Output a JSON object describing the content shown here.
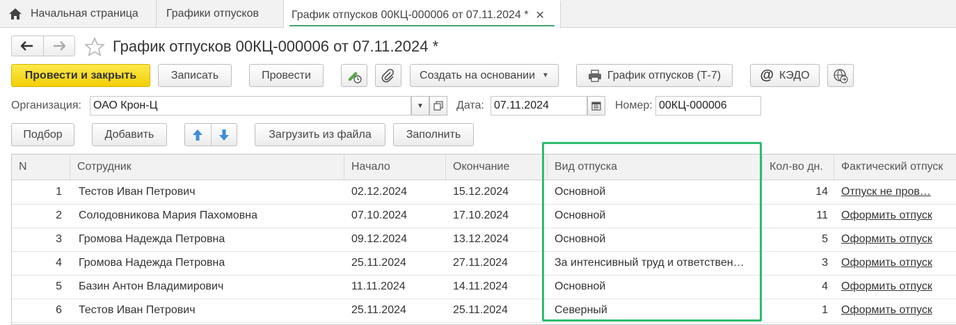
{
  "tabs": [
    {
      "label": "Начальная страница"
    },
    {
      "label": "Графики отпусков"
    },
    {
      "label": "График отпусков 00КЦ-000006 от 07.11.2024 *"
    }
  ],
  "title": "График отпусков 00КЦ-000006 от 07.11.2024 *",
  "toolbar": {
    "post_close": "Провести и закрыть",
    "save": "Записать",
    "post": "Провести",
    "create_based": "Создать на основании",
    "print_t7": "График отпусков (Т-7)",
    "kedo": "КЭДО"
  },
  "form": {
    "org_label": "Организация:",
    "org_value": "ОАО Крон-Ц",
    "date_label": "Дата:",
    "date_value": "07.11.2024",
    "number_label": "Номер:",
    "number_value": "00КЦ-000006"
  },
  "table_toolbar": {
    "pick": "Подбор",
    "add": "Добавить",
    "load": "Загрузить из файла",
    "fill": "Заполнить"
  },
  "table": {
    "headers": [
      "N",
      "Сотрудник",
      "Начало",
      "Окончание",
      "Вид отпуска",
      "Кол-во дн.",
      "Фактический отпуск"
    ],
    "rows": [
      {
        "n": "1",
        "employee": "Тестов Иван Петрович",
        "start": "02.12.2024",
        "end": "15.12.2024",
        "type": "Основной",
        "days": "14",
        "actual": "Отпуск не пров…"
      },
      {
        "n": "2",
        "employee": "Солодовникова Мария Пахомовна",
        "start": "07.10.2024",
        "end": "17.10.2024",
        "type": "Основной",
        "days": "11",
        "actual": "Оформить отпуск"
      },
      {
        "n": "3",
        "employee": "Громова Надежда Петровна",
        "start": "09.12.2024",
        "end": "13.12.2024",
        "type": "Основной",
        "days": "5",
        "actual": "Оформить отпуск"
      },
      {
        "n": "4",
        "employee": "Громова Надежда Петровна",
        "start": "25.11.2024",
        "end": "27.11.2024",
        "type": "За интенсивный труд и ответствен…",
        "days": "3",
        "actual": "Оформить отпуск"
      },
      {
        "n": "5",
        "employee": "Базин Антон Владимирович",
        "start": "11.11.2024",
        "end": "14.11.2024",
        "type": "Основной",
        "days": "4",
        "actual": "Оформить отпуск"
      },
      {
        "n": "6",
        "employee": "Тестов Иван Петрович",
        "start": "25.11.2024",
        "end": "25.11.2024",
        "type": "Северный",
        "days": "1",
        "actual": "Оформить отпуск"
      }
    ]
  },
  "colors": {
    "accent_green": "#2dbd6e",
    "primary_yellow": "#f3cf09",
    "arrow_blue": "#3d8fd6"
  }
}
